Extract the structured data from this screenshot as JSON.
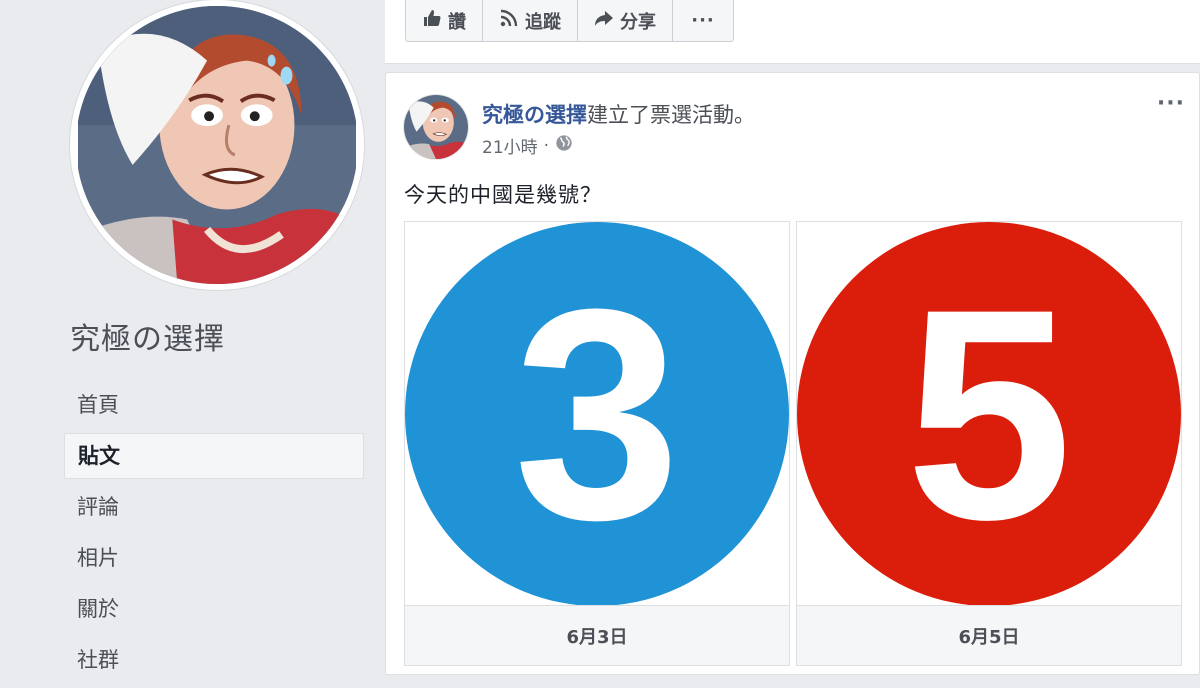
{
  "sidebar": {
    "page_name": "究極の選擇",
    "nav": [
      {
        "label": "首頁",
        "active": false
      },
      {
        "label": "貼文",
        "active": true
      },
      {
        "label": "評論",
        "active": false
      },
      {
        "label": "相片",
        "active": false
      },
      {
        "label": "關於",
        "active": false
      },
      {
        "label": "社群",
        "active": false
      }
    ]
  },
  "actions": {
    "like_label": "讚",
    "follow_label": "追蹤",
    "share_label": "分享",
    "more_label": "···"
  },
  "post": {
    "author": "究極の選擇",
    "action_text": "建立了票選活動。",
    "time": "21小時",
    "separator": "·",
    "options_label": "···",
    "question": "今天的中國是幾號？",
    "poll": [
      {
        "number": "3",
        "label": "6月3日",
        "color": "#2093d7"
      },
      {
        "number": "5",
        "label": "6月5日",
        "color": "#db1e0b"
      }
    ]
  },
  "colors": {
    "link": "#365899",
    "background": "#e9ebee"
  }
}
